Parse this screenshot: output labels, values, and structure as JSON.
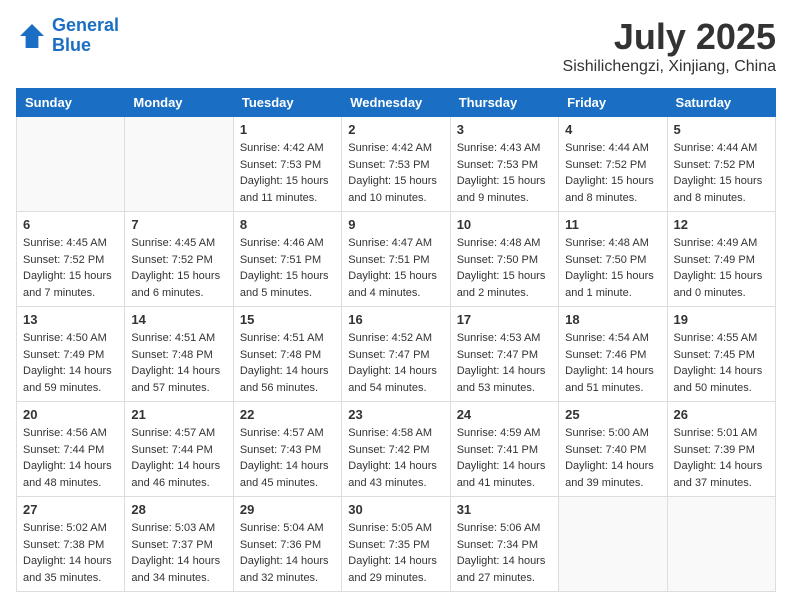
{
  "header": {
    "logo_line1": "General",
    "logo_line2": "Blue",
    "title": "July 2025",
    "location": "Sishilichengzi, Xinjiang, China"
  },
  "weekdays": [
    "Sunday",
    "Monday",
    "Tuesday",
    "Wednesday",
    "Thursday",
    "Friday",
    "Saturday"
  ],
  "weeks": [
    [
      {
        "day": "",
        "sunrise": "",
        "sunset": "",
        "daylight": "",
        "empty": true
      },
      {
        "day": "",
        "sunrise": "",
        "sunset": "",
        "daylight": "",
        "empty": true
      },
      {
        "day": "1",
        "sunrise": "Sunrise: 4:42 AM",
        "sunset": "Sunset: 7:53 PM",
        "daylight": "Daylight: 15 hours and 11 minutes.",
        "empty": false
      },
      {
        "day": "2",
        "sunrise": "Sunrise: 4:42 AM",
        "sunset": "Sunset: 7:53 PM",
        "daylight": "Daylight: 15 hours and 10 minutes.",
        "empty": false
      },
      {
        "day": "3",
        "sunrise": "Sunrise: 4:43 AM",
        "sunset": "Sunset: 7:53 PM",
        "daylight": "Daylight: 15 hours and 9 minutes.",
        "empty": false
      },
      {
        "day": "4",
        "sunrise": "Sunrise: 4:44 AM",
        "sunset": "Sunset: 7:52 PM",
        "daylight": "Daylight: 15 hours and 8 minutes.",
        "empty": false
      },
      {
        "day": "5",
        "sunrise": "Sunrise: 4:44 AM",
        "sunset": "Sunset: 7:52 PM",
        "daylight": "Daylight: 15 hours and 8 minutes.",
        "empty": false
      }
    ],
    [
      {
        "day": "6",
        "sunrise": "Sunrise: 4:45 AM",
        "sunset": "Sunset: 7:52 PM",
        "daylight": "Daylight: 15 hours and 7 minutes.",
        "empty": false
      },
      {
        "day": "7",
        "sunrise": "Sunrise: 4:45 AM",
        "sunset": "Sunset: 7:52 PM",
        "daylight": "Daylight: 15 hours and 6 minutes.",
        "empty": false
      },
      {
        "day": "8",
        "sunrise": "Sunrise: 4:46 AM",
        "sunset": "Sunset: 7:51 PM",
        "daylight": "Daylight: 15 hours and 5 minutes.",
        "empty": false
      },
      {
        "day": "9",
        "sunrise": "Sunrise: 4:47 AM",
        "sunset": "Sunset: 7:51 PM",
        "daylight": "Daylight: 15 hours and 4 minutes.",
        "empty": false
      },
      {
        "day": "10",
        "sunrise": "Sunrise: 4:48 AM",
        "sunset": "Sunset: 7:50 PM",
        "daylight": "Daylight: 15 hours and 2 minutes.",
        "empty": false
      },
      {
        "day": "11",
        "sunrise": "Sunrise: 4:48 AM",
        "sunset": "Sunset: 7:50 PM",
        "daylight": "Daylight: 15 hours and 1 minute.",
        "empty": false
      },
      {
        "day": "12",
        "sunrise": "Sunrise: 4:49 AM",
        "sunset": "Sunset: 7:49 PM",
        "daylight": "Daylight: 15 hours and 0 minutes.",
        "empty": false
      }
    ],
    [
      {
        "day": "13",
        "sunrise": "Sunrise: 4:50 AM",
        "sunset": "Sunset: 7:49 PM",
        "daylight": "Daylight: 14 hours and 59 minutes.",
        "empty": false
      },
      {
        "day": "14",
        "sunrise": "Sunrise: 4:51 AM",
        "sunset": "Sunset: 7:48 PM",
        "daylight": "Daylight: 14 hours and 57 minutes.",
        "empty": false
      },
      {
        "day": "15",
        "sunrise": "Sunrise: 4:51 AM",
        "sunset": "Sunset: 7:48 PM",
        "daylight": "Daylight: 14 hours and 56 minutes.",
        "empty": false
      },
      {
        "day": "16",
        "sunrise": "Sunrise: 4:52 AM",
        "sunset": "Sunset: 7:47 PM",
        "daylight": "Daylight: 14 hours and 54 minutes.",
        "empty": false
      },
      {
        "day": "17",
        "sunrise": "Sunrise: 4:53 AM",
        "sunset": "Sunset: 7:47 PM",
        "daylight": "Daylight: 14 hours and 53 minutes.",
        "empty": false
      },
      {
        "day": "18",
        "sunrise": "Sunrise: 4:54 AM",
        "sunset": "Sunset: 7:46 PM",
        "daylight": "Daylight: 14 hours and 51 minutes.",
        "empty": false
      },
      {
        "day": "19",
        "sunrise": "Sunrise: 4:55 AM",
        "sunset": "Sunset: 7:45 PM",
        "daylight": "Daylight: 14 hours and 50 minutes.",
        "empty": false
      }
    ],
    [
      {
        "day": "20",
        "sunrise": "Sunrise: 4:56 AM",
        "sunset": "Sunset: 7:44 PM",
        "daylight": "Daylight: 14 hours and 48 minutes.",
        "empty": false
      },
      {
        "day": "21",
        "sunrise": "Sunrise: 4:57 AM",
        "sunset": "Sunset: 7:44 PM",
        "daylight": "Daylight: 14 hours and 46 minutes.",
        "empty": false
      },
      {
        "day": "22",
        "sunrise": "Sunrise: 4:57 AM",
        "sunset": "Sunset: 7:43 PM",
        "daylight": "Daylight: 14 hours and 45 minutes.",
        "empty": false
      },
      {
        "day": "23",
        "sunrise": "Sunrise: 4:58 AM",
        "sunset": "Sunset: 7:42 PM",
        "daylight": "Daylight: 14 hours and 43 minutes.",
        "empty": false
      },
      {
        "day": "24",
        "sunrise": "Sunrise: 4:59 AM",
        "sunset": "Sunset: 7:41 PM",
        "daylight": "Daylight: 14 hours and 41 minutes.",
        "empty": false
      },
      {
        "day": "25",
        "sunrise": "Sunrise: 5:00 AM",
        "sunset": "Sunset: 7:40 PM",
        "daylight": "Daylight: 14 hours and 39 minutes.",
        "empty": false
      },
      {
        "day": "26",
        "sunrise": "Sunrise: 5:01 AM",
        "sunset": "Sunset: 7:39 PM",
        "daylight": "Daylight: 14 hours and 37 minutes.",
        "empty": false
      }
    ],
    [
      {
        "day": "27",
        "sunrise": "Sunrise: 5:02 AM",
        "sunset": "Sunset: 7:38 PM",
        "daylight": "Daylight: 14 hours and 35 minutes.",
        "empty": false
      },
      {
        "day": "28",
        "sunrise": "Sunrise: 5:03 AM",
        "sunset": "Sunset: 7:37 PM",
        "daylight": "Daylight: 14 hours and 34 minutes.",
        "empty": false
      },
      {
        "day": "29",
        "sunrise": "Sunrise: 5:04 AM",
        "sunset": "Sunset: 7:36 PM",
        "daylight": "Daylight: 14 hours and 32 minutes.",
        "empty": false
      },
      {
        "day": "30",
        "sunrise": "Sunrise: 5:05 AM",
        "sunset": "Sunset: 7:35 PM",
        "daylight": "Daylight: 14 hours and 29 minutes.",
        "empty": false
      },
      {
        "day": "31",
        "sunrise": "Sunrise: 5:06 AM",
        "sunset": "Sunset: 7:34 PM",
        "daylight": "Daylight: 14 hours and 27 minutes.",
        "empty": false
      },
      {
        "day": "",
        "sunrise": "",
        "sunset": "",
        "daylight": "",
        "empty": true
      },
      {
        "day": "",
        "sunrise": "",
        "sunset": "",
        "daylight": "",
        "empty": true
      }
    ]
  ]
}
